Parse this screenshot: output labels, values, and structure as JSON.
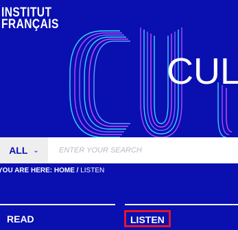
{
  "brand": {
    "line1": "INSTITUT",
    "line2": "FRANÇAIS"
  },
  "hero": {
    "word": "CUL"
  },
  "search": {
    "filter_label": "ALL",
    "placeholder": "ENTER YOUR SEARCH",
    "value": ""
  },
  "breadcrumb": {
    "prefix": "YOU ARE HERE:",
    "home": "HOME",
    "separator": "/",
    "current": "LISTEN"
  },
  "tabs": [
    {
      "label": "READ",
      "active": false
    },
    {
      "label": "LISTEN",
      "active": true
    }
  ],
  "colors": {
    "brand_blue": "#0a0fb0",
    "highlight_red": "#e0182a",
    "neon_cyan": "#3ad6ff",
    "neon_purple": "#b24bff"
  },
  "icons": {
    "filter_chevron": "chevron-down-icon"
  }
}
